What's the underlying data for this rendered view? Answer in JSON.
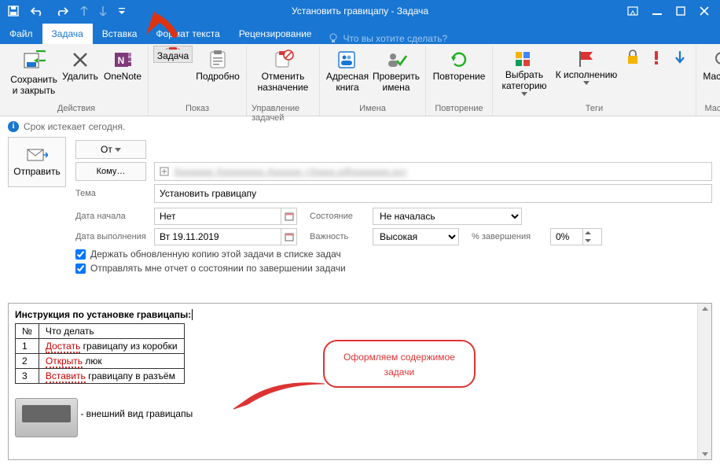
{
  "window": {
    "title": "Установить гравицапу - Задача"
  },
  "tabs": {
    "file": "Файл",
    "task": "Задача",
    "insert": "Вставка",
    "format": "Формат текста",
    "review": "Рецензирование",
    "tell": "Что вы хотите сделать?"
  },
  "ribbon": {
    "actions": {
      "label": "Действия",
      "save_close": "Сохранить\nи закрыть",
      "delete": "Удалить",
      "onenote": "OneNote"
    },
    "show": {
      "label": "Показ",
      "task": "Задача",
      "details": "Подробно"
    },
    "manage": {
      "label": "Управление задачей",
      "cancel": "Отменить\nназначение"
    },
    "names": {
      "label": "Имена",
      "address": "Адресная\nкнига",
      "check": "Проверить\nимена"
    },
    "repeat": {
      "label": "Повторение",
      "btn": "Повторение"
    },
    "tags": {
      "label": "Теги",
      "category": "Выбрать\nкатегорию",
      "followup": "К исполнению"
    },
    "zoom": {
      "label": "Масштаб",
      "btn": "Масштаб"
    }
  },
  "info": "Срок истекает сегодня.",
  "form": {
    "send": "Отправить",
    "from_btn": "От",
    "from_val": "                         ",
    "to_btn": "Кому…",
    "to_val": "                                                              ",
    "subject_lbl": "Тема",
    "subject_val": "Установить гравицапу",
    "start_lbl": "Дата начала",
    "start_val": "Нет",
    "due_lbl": "Дата выполнения",
    "due_val": "Вт 19.11.2019",
    "state_lbl": "Состояние",
    "state_val": "Не началась",
    "prio_lbl": "Важность",
    "prio_val": "Высокая",
    "pct_lbl": "% завершения",
    "pct_val": "0%",
    "chk1": "Держать обновленную копию этой задачи в списке задач",
    "chk2": "Отправлять мне отчет о состоянии по завершении задачи"
  },
  "body": {
    "heading": "Инструкция по установке гравицапы:",
    "cols": {
      "n": "№",
      "what": "Что делать"
    },
    "rows": [
      {
        "n": "1",
        "r": "Достать",
        "rest": " гравицапу из коробки"
      },
      {
        "n": "2",
        "r": "Открыть",
        "rest": " люк"
      },
      {
        "n": "3",
        "r": "Вставить",
        "rest": " гравицапу в разъём"
      }
    ],
    "caption": " - внешний вид гравицапы"
  },
  "callout": {
    "l1": "Оформляем содержимое",
    "l2": "задачи"
  }
}
